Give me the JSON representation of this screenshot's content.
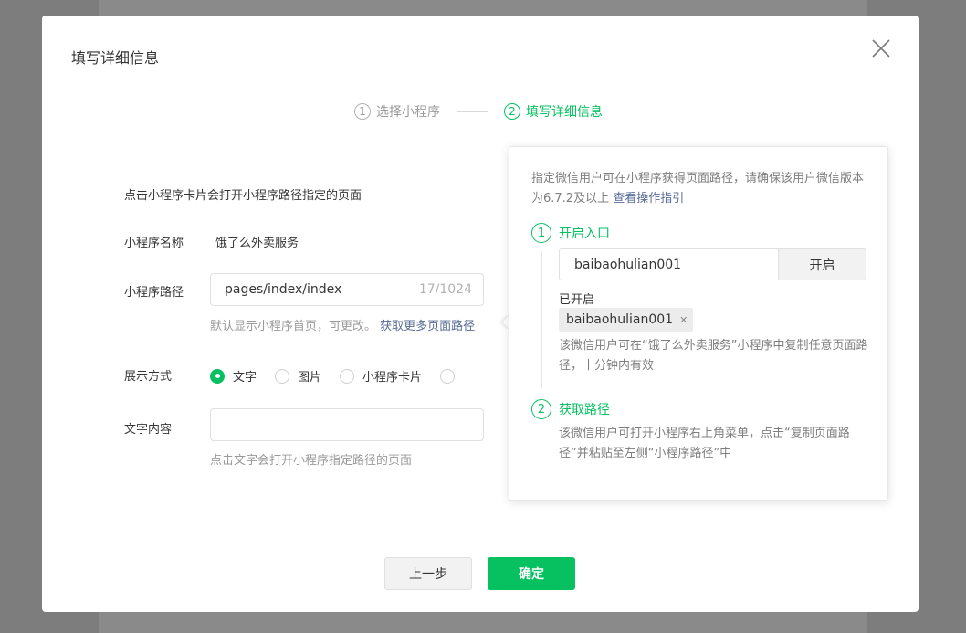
{
  "dialog": {
    "title": "填写详细信息"
  },
  "steps": [
    {
      "num": "1",
      "label": "选择小程序"
    },
    {
      "num": "2",
      "label": "填写详细信息"
    }
  ],
  "form": {
    "description": "点击小程序卡片会打开小程序路径指定的页面",
    "name_label": "小程序名称",
    "name_value": "饿了么外卖服务",
    "path_label": "小程序路径",
    "path_value": "pages/index/index",
    "path_counter": "17/1024",
    "path_hint": "默认显示小程序首页，可更改。",
    "path_link": "获取更多页面路径",
    "display_label": "展示方式",
    "display_options": [
      "文字",
      "图片",
      "小程序卡片"
    ],
    "display_selected": "文字",
    "text_label": "文字内容",
    "text_value": "",
    "text_hint": "点击文字会打开小程序指定路径的页面"
  },
  "popover": {
    "intro": "指定微信用户可在小程序获得页面路径，请确保该用户微信版本为6.7.2及以上",
    "intro_link": "查看操作指引",
    "step1_num": "1",
    "step1_title": "开启入口",
    "wechat_id_value": "baibaohulian001",
    "open_button": "开启",
    "enabled_label": "已开启",
    "enabled_tag": "baibaohulian001",
    "step1_note": "该微信用户可在“饿了么外卖服务”小程序中复制任意页面路径，十分钟内有效",
    "step2_num": "2",
    "step2_title": "获取路径",
    "step2_note": "该微信用户可打开小程序右上角菜单，点击“复制页面路径”并粘贴至左侧“小程序路径”中"
  },
  "footer": {
    "prev_button": "上一步",
    "ok_button": "确定"
  },
  "colors": {
    "accent": "#07c160",
    "link": "#576b95",
    "overlay": "#7d7d7d"
  },
  "icons": {
    "close": "close-icon"
  }
}
